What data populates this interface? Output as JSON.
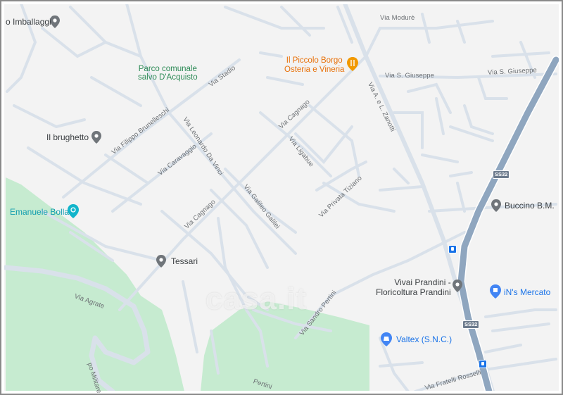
{
  "map": {
    "colors": {
      "background": "#f3f3f3",
      "road": "#d9e1ea",
      "highway": "#8fa6bf",
      "park": "#c6ebd0",
      "frame": "#8a8a8a"
    },
    "watermark": "casa.it",
    "streets": {
      "via_modure": "Via Modurè",
      "via_s_giuseppe_1": "Via S. Giuseppe",
      "via_s_giuseppe_2": "Via S. Giuseppe",
      "via_stadio": "Via Stadio",
      "via_filippo_brunelleschi": "Via Filippo Brunelleschi",
      "via_caravaggio": "Via Caravaggio",
      "via_leonardo_da_vinci": "Via Leonardo Da Vinci",
      "via_cagnago_1": "Via Cagnago",
      "via_cagnago_2": "Via Cagnago",
      "via_ligabue": "Via Ligabue",
      "via_galileo_galilei": "Via Galileo Galilei",
      "via_privata_tiziano": "Via Privata Tiziano",
      "via_a_e_l_zanotti": "Via A. e L. Zanotti",
      "via_agrate": "Via Agrate",
      "via_sandro_pertini": "Via Sandro Pertini",
      "via_pertini_bottom": "Pertini",
      "via_fratelli_rosselli": "Via Fratelli Rosselli",
      "via_militare": "po Militare"
    },
    "road_shields": {
      "ss32_top": "SS32",
      "ss32_bottom": "SS32"
    },
    "places": {
      "imballaggi": {
        "label": "o Imballaggi",
        "icon": "place-pin-icon"
      },
      "parco": {
        "label1": "Parco comunale",
        "label2": "salvo D'Acquisto",
        "icon": "park-icon"
      },
      "piccolo_borgo": {
        "label1": "Il Piccolo Borgo",
        "label2": "Osteria e Vineria",
        "icon": "restaurant-icon"
      },
      "brughetto": {
        "label": "Il brughetto",
        "icon": "place-pin-icon"
      },
      "emanuele_bolla": {
        "label": "Emanuele Bolla",
        "icon": "salon-icon"
      },
      "tessari": {
        "label": "Tessari",
        "icon": "place-pin-icon"
      },
      "buccino": {
        "label": "Buccino B.M.",
        "icon": "place-pin-icon"
      },
      "vivai": {
        "label1": "Vivai Prandini -",
        "label2": "Floricoltura Prandini",
        "icon": "place-pin-icon"
      },
      "ins_mercato": {
        "label": "iN's Mercato",
        "icon": "shopping-icon"
      },
      "valtex": {
        "label": "Valtex (S.N.C.)",
        "icon": "shopping-bag-icon"
      }
    }
  }
}
